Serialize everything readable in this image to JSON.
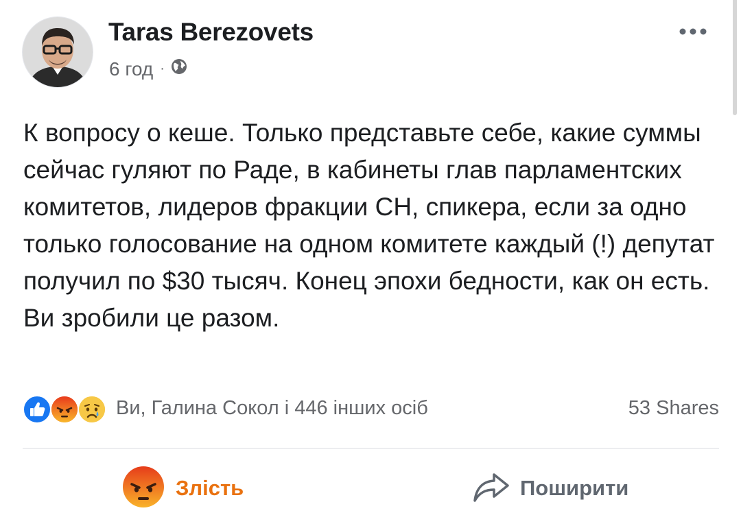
{
  "post": {
    "author": "Taras Berezovets",
    "time": "6 год",
    "separator": "·",
    "visibility_icon": "globe-icon",
    "more_icon": "more-horizontal-icon",
    "text": "К вопросу о кеше. Только представьте себе, какие суммы сейчас гуляют по Раде, в кабинеты глав парламентских комитетов, лидеров фракции СН, спикера, если за одно только голосование на одном комитете каждый (!) депутат получил по $30 тысяч. Конец эпохи бедности, как он есть. Ви зробили це разом."
  },
  "reactions": {
    "icons": [
      "like-reaction-icon",
      "angry-reaction-icon",
      "sad-reaction-icon"
    ],
    "summary": "Ви, Галина Сокол і 446 інших осіб",
    "shares": "53 Shares"
  },
  "actions": {
    "react_label": "Злість",
    "react_icon": "angry-reaction-icon",
    "share_label": "Поширити",
    "share_icon": "share-arrow-icon"
  },
  "colors": {
    "like_blue": "#1877f2",
    "angry_orange": "#e9710f",
    "muted_text": "#65676b"
  }
}
